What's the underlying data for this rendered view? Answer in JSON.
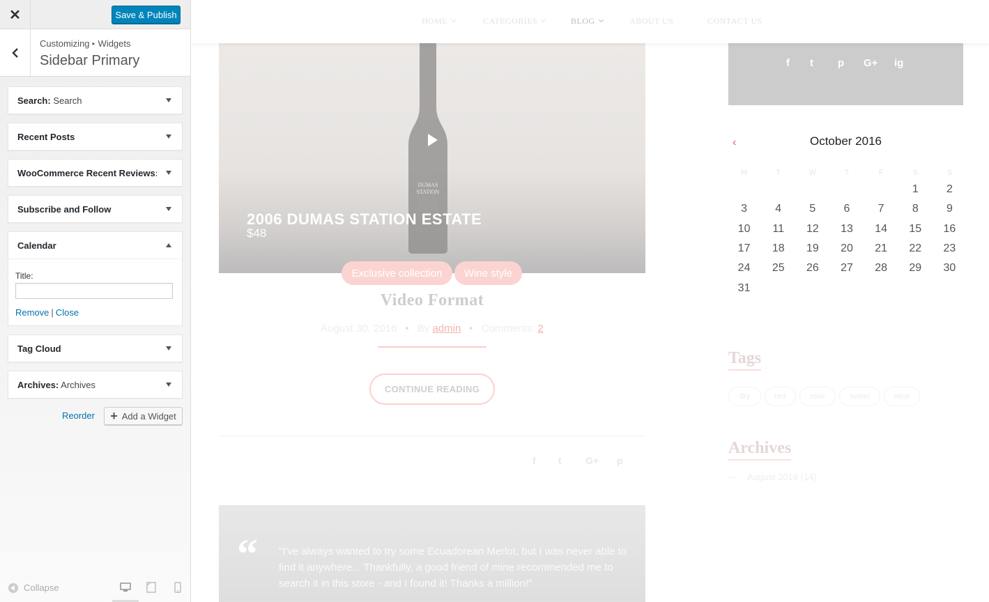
{
  "customizer": {
    "close_icon": "close-icon",
    "save_label": "Save & Publish",
    "breadcrumb": {
      "parent": "Customizing",
      "child": "Widgets"
    },
    "section_title": "Sidebar Primary",
    "widgets": [
      {
        "bold": "Search:",
        "normal": " Search"
      },
      {
        "bold": "Recent Posts",
        "normal": ""
      },
      {
        "bold": "WooCommerce Recent Reviews: ...",
        "normal": ""
      },
      {
        "bold": "Subscribe and Follow",
        "normal": ""
      },
      {
        "bold": "Calendar",
        "normal": ""
      },
      {
        "bold": "Tag Cloud",
        "normal": ""
      },
      {
        "bold": "Archives:",
        "normal": " Archives"
      }
    ],
    "calendar_form": {
      "title_label": "Title:",
      "title_value": "",
      "remove": "Remove",
      "separator": "|",
      "close": "Close"
    },
    "reorder_label": "Reorder",
    "add_widget_label": "Add a Widget",
    "collapse_label": "Collapse",
    "devices": [
      "desktop-icon",
      "tablet-icon",
      "mobile-icon"
    ]
  },
  "preview": {
    "nav": [
      {
        "label": "HOME",
        "chevron": true
      },
      {
        "label": "CATEGORIES",
        "chevron": true
      },
      {
        "label": "BLOG",
        "chevron": true,
        "active": true
      },
      {
        "label": "ABOUT US",
        "chevron": false
      },
      {
        "label": "CONTACT US",
        "chevron": false
      }
    ],
    "video": {
      "title": "2006 DUMAS STATION ESTATE",
      "price": "$48",
      "bottle_label": [
        "DUMAS",
        "STATION"
      ]
    },
    "categories": [
      "Exclusive collection",
      "Wine style"
    ],
    "post_title": "Video Format",
    "meta": {
      "date": "August 30, 2016",
      "by": "By",
      "author": "admin",
      "comments_label": "Comments:",
      "comments_count": "2"
    },
    "continue_label": "CONTINUE READING",
    "share_icons": [
      "f",
      "t",
      "G+",
      "p"
    ],
    "quote": {
      "mark": "“",
      "text": "\"I've always wanted to try some Ecuadorean Merlot, but I was never able to find it anywhere... Thankfully, a good friend of mine recommended me to search it in this store - and I found it! Thanks a million!\""
    },
    "social_icons": [
      "f",
      "t",
      "p",
      "G+",
      "ig"
    ],
    "calendar": {
      "caption": "October 2016",
      "prev": "‹",
      "weekdays": [
        "M",
        "T",
        "W",
        "T",
        "F",
        "S",
        "S"
      ],
      "weeks": [
        [
          "",
          "",
          "",
          "",
          "",
          "1",
          "2"
        ],
        [
          "3",
          "4",
          "5",
          "6",
          "7",
          "8",
          "9"
        ],
        [
          "10",
          "11",
          "12",
          "13",
          "14",
          "15",
          "16"
        ],
        [
          "17",
          "18",
          "19",
          "20",
          "21",
          "22",
          "23"
        ],
        [
          "24",
          "25",
          "26",
          "27",
          "28",
          "29",
          "30"
        ],
        [
          "31",
          "",
          "",
          "",
          "",
          "",
          ""
        ]
      ]
    },
    "tags_title": "Tags",
    "tags": [
      "dry",
      "red",
      "rose",
      "sweet",
      "wine"
    ],
    "archives_title": "Archives",
    "archives": [
      {
        "label": "August 2016 (14)",
        "dash": "—"
      }
    ],
    "colors": {
      "accent": "#0085ba",
      "link": "#0073aa",
      "pink": "#fbd4d2"
    }
  }
}
